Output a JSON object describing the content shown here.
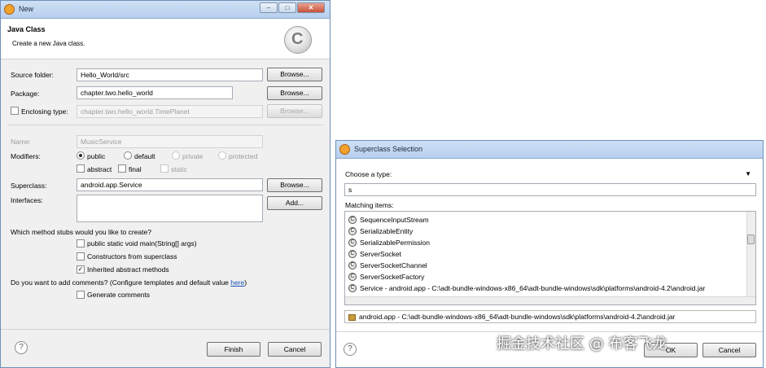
{
  "java_class_dialog": {
    "title": "New",
    "header": {
      "title": "Java Class",
      "description": "Create a new Java class."
    },
    "source_folder": {
      "label": "Source folder:",
      "value": "Hello_World/src",
      "browse": "Browse..."
    },
    "package": {
      "label": "Package:",
      "value": "chapter.two.hello_world",
      "browse": "Browse..."
    },
    "enclosing_type": {
      "label": "Enclosing type:",
      "value": "chapter.two.hello_world.TimePlanet",
      "browse": "Browse...",
      "checked": false
    },
    "name": {
      "label": "Name:",
      "value": "MusicService"
    },
    "modifiers": {
      "label": "Modifiers:",
      "public": "public",
      "default": "default",
      "private": "private",
      "protected": "protected",
      "abstract": "abstract",
      "final": "final",
      "static": "static",
      "selected": "public"
    },
    "superclass": {
      "label": "Superclass:",
      "value": "android.app.Service",
      "browse": "Browse..."
    },
    "interfaces": {
      "label": "Interfaces:",
      "add": "Add..."
    },
    "method_stubs": {
      "question": "Which method stubs would you like to create?",
      "main": "public static void main(String[] args)",
      "constructors": "Constructors from superclass",
      "inherited": "Inherited abstract methods"
    },
    "comments": {
      "question": "Do you want to add comments? (Configure templates and default value ",
      "link": "here",
      "close": ")",
      "generate": "Generate comments"
    },
    "finish": "Finish",
    "cancel": "Cancel",
    "help": "?"
  },
  "superclass_dialog": {
    "title": "Superclass Selection",
    "choose_label": "Choose a type:",
    "search_value": "s",
    "matching_label": "Matching items:",
    "items": [
      {
        "name": "SequenceInputStream",
        "mark": ""
      },
      {
        "name": "SerializableEntity",
        "mark": ""
      },
      {
        "name": "SerializablePermission",
        "mark": "F"
      },
      {
        "name": "ServerSocket",
        "mark": ""
      },
      {
        "name": "ServerSocketChannel",
        "mark": "A"
      },
      {
        "name": "ServerSocketFactory",
        "mark": "A"
      },
      {
        "name": "Service - android.app - C:\\adt-bundle-windows-x86_64\\adt-bundle-windows\\sdk\\platforms\\android-4.2\\android.jar",
        "mark": "A"
      }
    ],
    "package_info": "android.app - C:\\adt-bundle-windows-x86_64\\adt-bundle-windows\\sdk\\platforms\\android-4.2\\android.jar",
    "ok": "OK",
    "cancel": "Cancel",
    "help": "?"
  },
  "watermark": "掘金技术社区 @ 布客飞龙"
}
